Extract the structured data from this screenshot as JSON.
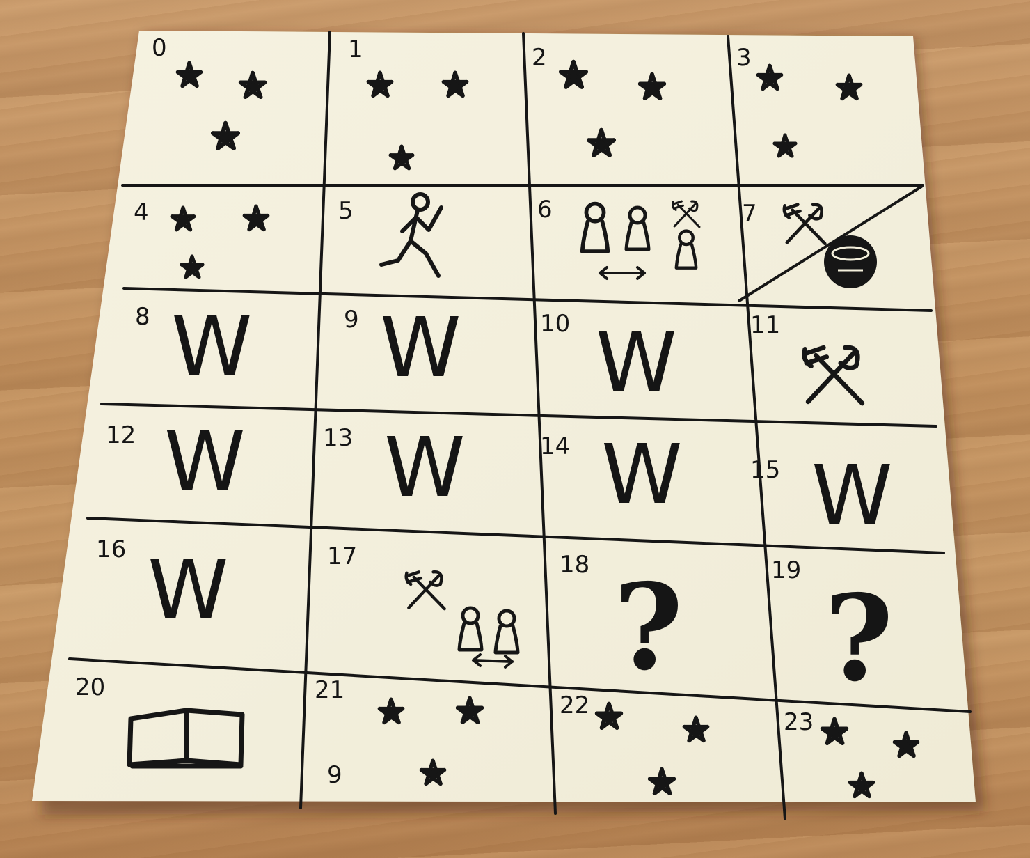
{
  "photo": {
    "subject_icons": {
      "background": "wooden-table",
      "note": "sticky-note-grid"
    },
    "colors": {
      "paper": "#f4f0dc",
      "ink": "#161616",
      "wood": "#c4935f"
    }
  },
  "cells": [
    {
      "id": "c0",
      "number": "0",
      "icon": "stars-icon"
    },
    {
      "id": "c1",
      "number": "1",
      "icon": "stars-icon"
    },
    {
      "id": "c2",
      "number": "2",
      "icon": "stars-icon"
    },
    {
      "id": "c3",
      "number": "3",
      "icon": "stars-icon"
    },
    {
      "id": "c4",
      "number": "4",
      "icon": "stars-icon"
    },
    {
      "id": "c5",
      "number": "5",
      "icon": "running-person-icon"
    },
    {
      "id": "c6",
      "number": "6",
      "icon": "people-pawns-icon"
    },
    {
      "id": "c7",
      "number": "7",
      "icon": "crossed-weapons-and-pot-icon"
    },
    {
      "id": "c8",
      "number": "8",
      "label": "W"
    },
    {
      "id": "c9",
      "number": "9",
      "label": "W"
    },
    {
      "id": "c10",
      "number": "10",
      "label": "W"
    },
    {
      "id": "c11",
      "number": "11",
      "icon": "crossed-weapons-icon"
    },
    {
      "id": "c12",
      "number": "12",
      "label": "W"
    },
    {
      "id": "c13",
      "number": "13",
      "label": "W"
    },
    {
      "id": "c14",
      "number": "14",
      "label": "W"
    },
    {
      "id": "c15",
      "number": "15",
      "label": "W"
    },
    {
      "id": "c16",
      "number": "16",
      "label": "W"
    },
    {
      "id": "c17",
      "number": "17",
      "icon": "crossed-weapons-with-pawns-icon"
    },
    {
      "id": "c18",
      "number": "18",
      "label": "?"
    },
    {
      "id": "c19",
      "number": "19",
      "label": "?"
    },
    {
      "id": "c20",
      "number": "20",
      "icon": "open-book-icon"
    },
    {
      "id": "c21",
      "number": "21",
      "icon": "stars-icon",
      "extra_label": "9"
    },
    {
      "id": "c22",
      "number": "22",
      "icon": "stars-icon"
    },
    {
      "id": "c23",
      "number": "23",
      "icon": "stars-icon"
    }
  ]
}
